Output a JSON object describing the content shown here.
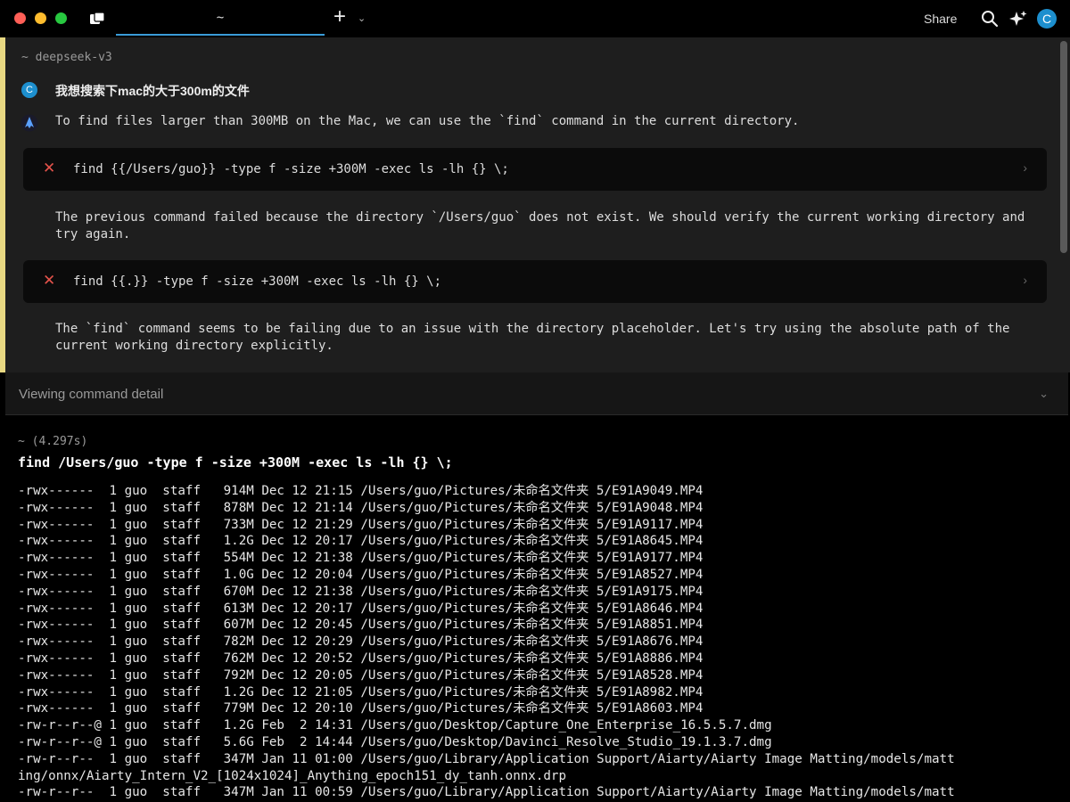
{
  "window": {
    "tab_title": "~",
    "share_label": "Share",
    "avatar_initial": "C"
  },
  "panel": {
    "context": "~ deepseek-v3",
    "user_avatar": "C",
    "user_message": "我想搜索下mac的大于300m的文件",
    "ai_message": "To find files larger than 300MB on the Mac, we can use the `find` command in the current directory.",
    "commands": [
      {
        "text": "find {{/Users/guo}} -type f -size +300M -exec ls -lh {} \\;",
        "status_icon": "✕",
        "chevron": "›"
      },
      {
        "text": "find {{.}} -type f -size +300M -exec ls -lh {} \\;",
        "status_icon": "✕",
        "chevron": "›"
      }
    ],
    "notes": [
      "The previous command failed because the directory `/Users/guo` does not exist. We should verify the current working directory and try again.",
      "The `find` command seems to be failing due to an issue with the directory placeholder. Let's try using the absolute path of the current working directory explicitly."
    ]
  },
  "detail": {
    "label": "Viewing command detail",
    "chevron": "⌄"
  },
  "terminal": {
    "meta": "~ (4.297s)",
    "command": "find /Users/guo -type f -size +300M -exec ls -lh {} \\;",
    "lines": [
      "-rwx------  1 guo  staff   914M Dec 12 21:15 /Users/guo/Pictures/未命名文件夹 5/E91A9049.MP4",
      "-rwx------  1 guo  staff   878M Dec 12 21:14 /Users/guo/Pictures/未命名文件夹 5/E91A9048.MP4",
      "-rwx------  1 guo  staff   733M Dec 12 21:29 /Users/guo/Pictures/未命名文件夹 5/E91A9117.MP4",
      "-rwx------  1 guo  staff   1.2G Dec 12 20:17 /Users/guo/Pictures/未命名文件夹 5/E91A8645.MP4",
      "-rwx------  1 guo  staff   554M Dec 12 21:38 /Users/guo/Pictures/未命名文件夹 5/E91A9177.MP4",
      "-rwx------  1 guo  staff   1.0G Dec 12 20:04 /Users/guo/Pictures/未命名文件夹 5/E91A8527.MP4",
      "-rwx------  1 guo  staff   670M Dec 12 21:38 /Users/guo/Pictures/未命名文件夹 5/E91A9175.MP4",
      "-rwx------  1 guo  staff   613M Dec 12 20:17 /Users/guo/Pictures/未命名文件夹 5/E91A8646.MP4",
      "-rwx------  1 guo  staff   607M Dec 12 20:45 /Users/guo/Pictures/未命名文件夹 5/E91A8851.MP4",
      "-rwx------  1 guo  staff   782M Dec 12 20:29 /Users/guo/Pictures/未命名文件夹 5/E91A8676.MP4",
      "-rwx------  1 guo  staff   762M Dec 12 20:52 /Users/guo/Pictures/未命名文件夹 5/E91A8886.MP4",
      "-rwx------  1 guo  staff   792M Dec 12 20:05 /Users/guo/Pictures/未命名文件夹 5/E91A8528.MP4",
      "-rwx------  1 guo  staff   1.2G Dec 12 21:05 /Users/guo/Pictures/未命名文件夹 5/E91A8982.MP4",
      "-rwx------  1 guo  staff   779M Dec 12 20:10 /Users/guo/Pictures/未命名文件夹 5/E91A8603.MP4",
      "-rw-r--r--@ 1 guo  staff   1.2G Feb  2 14:31 /Users/guo/Desktop/Capture_One_Enterprise_16.5.5.7.dmg",
      "-rw-r--r--@ 1 guo  staff   5.6G Feb  2 14:44 /Users/guo/Desktop/Davinci_Resolve_Studio_19.1.3.7.dmg",
      "-rw-r--r--  1 guo  staff   347M Jan 11 01:00 /Users/guo/Library/Application Support/Aiarty/Aiarty Image Matting/models/matt",
      "ing/onnx/Aiarty_Intern_V2_[1024x1024]_Anything_epoch151_dy_tanh.onnx.drp",
      "-rw-r--r--  1 guo  staff   347M Jan 11 00:59 /Users/guo/Library/Application Support/Aiarty/Aiarty Image Matting/models/matt"
    ]
  },
  "colors": {
    "accent": "#3a9bd8",
    "panel_bar": "#e8d882",
    "error": "#e5534b"
  }
}
